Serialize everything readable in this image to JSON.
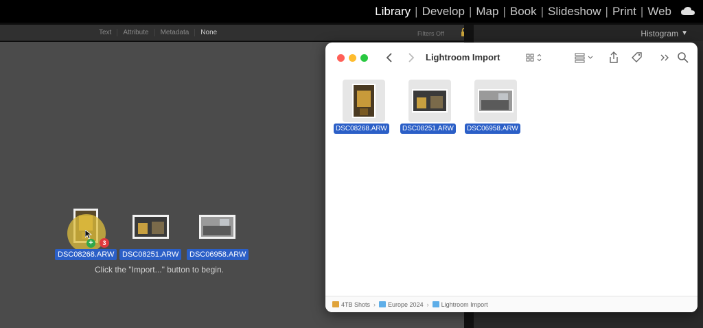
{
  "modules": {
    "items": [
      "Library",
      "Develop",
      "Map",
      "Book",
      "Slideshow",
      "Print",
      "Web"
    ],
    "active": "Library",
    "cloud_icon": "cloud-icon"
  },
  "filterbar": {
    "items": [
      "Text",
      "Attribute",
      "Metadata",
      "None"
    ],
    "selected": "None",
    "filters_off": "Filters Off"
  },
  "right_panel": {
    "histogram_label": "Histogram"
  },
  "grid": {
    "dragged_files": [
      "DSC08268.ARW",
      "DSC08251.ARW",
      "DSC06958.ARW"
    ],
    "hint": "Click the \"Import...\" button to begin.",
    "drag_count": "3",
    "plus_badge": "+"
  },
  "finder": {
    "title": "Lightroom Import",
    "files": [
      "DSC08268.ARW",
      "DSC08251.ARW",
      "DSC06958.ARW"
    ],
    "path": [
      "4TB Shots",
      "Europe 2024",
      "Lightroom Import"
    ],
    "colors": {
      "close": "#ff5f57",
      "minimize": "#febc2e",
      "zoom": "#28c840",
      "selection": "#2b5fc7"
    }
  }
}
